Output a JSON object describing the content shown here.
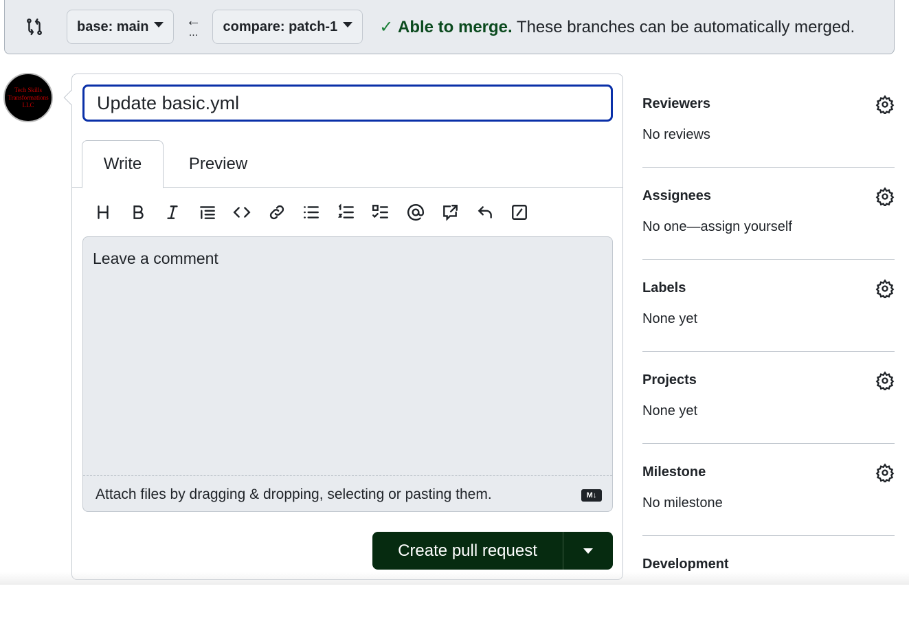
{
  "compare_bar": {
    "base": "base: main",
    "compare": "compare: patch-1",
    "arrow": "←",
    "dots": "...",
    "merge_status": "Able to merge.",
    "merge_message": " These branches can be automatically merged.",
    "status_color": "#1a7f37"
  },
  "avatar": {
    "text": "Tech Skills Transformations LLC"
  },
  "form": {
    "title_value": "Update basic.yml",
    "tabs": [
      {
        "label": "Write"
      },
      {
        "label": "Preview"
      }
    ],
    "toolbar": [
      "heading",
      "bold",
      "italic",
      "quote",
      "code",
      "link",
      "unordered-list",
      "ordered-list",
      "task-list",
      "mention",
      "reference",
      "reply",
      "slash-commands"
    ],
    "comment_placeholder": "Leave a comment",
    "attach_text": "Attach files by dragging & dropping, selecting or pasting them.",
    "markdown_badge": "M↓",
    "create_label": "Create pull request",
    "button_color": "#062b10"
  },
  "sidebar": [
    {
      "title": "Reviewers",
      "value": "No reviews"
    },
    {
      "title": "Assignees",
      "value": "No one—assign yourself"
    },
    {
      "title": "Labels",
      "value": "None yet"
    },
    {
      "title": "Projects",
      "value": "None yet"
    },
    {
      "title": "Milestone",
      "value": "No milestone"
    },
    {
      "title": "Development"
    }
  ]
}
